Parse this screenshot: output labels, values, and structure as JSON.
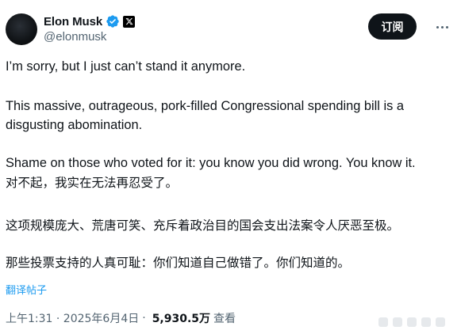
{
  "author": {
    "display_name": "Elon Musk",
    "handle": "@elonmusk",
    "verified_icon": "verified-badge-icon",
    "affiliation_icon": "x-logo-icon"
  },
  "actions": {
    "subscribe_label": "订阅",
    "more_icon": "more-options-icon"
  },
  "tweet": {
    "paragraphs": [
      "I’m sorry, but I just can’t stand it anymore.",
      "This massive, outrageous, pork-filled Congressional spending bill is a disgusting abomination.",
      "Shame on those who voted for it: you know you did wrong. You know it.",
      "对不起，我实在无法再忍受了。",
      "这项规模庞大、荒唐可笑、充斥着政治目的国会支出法案令人厌恶至极。",
      "那些投票支持的人真可耻：你们知道自己做错了。你们知道的。"
    ],
    "translate_label": "翻译帖子"
  },
  "meta": {
    "timestamp": "上午1:31 · 2025年6月4日",
    "separator": "·",
    "views_count": "5,930.5万",
    "views_label": "查看"
  },
  "colors": {
    "text": "#0f1419",
    "secondary": "#536471",
    "link": "#1d9bf0",
    "verified": "#1d9bf0",
    "button_bg": "#0f1419"
  }
}
